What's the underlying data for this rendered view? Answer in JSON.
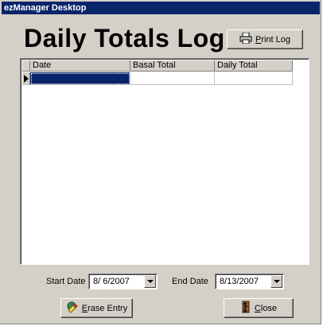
{
  "window": {
    "title": "ezManager Desktop"
  },
  "heading": "Daily Totals Log",
  "buttons": {
    "print_log": "Print Log",
    "erase_entry": "Erase Entry",
    "close": "Close"
  },
  "grid": {
    "columns": [
      "Date",
      "Basal Total",
      "Daily Total"
    ],
    "rows": [
      [
        "",
        "",
        ""
      ]
    ]
  },
  "filters": {
    "start_label": "Start Date",
    "start_value": "8/ 6/2007",
    "end_label": "End Date",
    "end_value": "8/13/2007"
  },
  "icons": {
    "print": "printer-icon",
    "erase": "eraser-icon",
    "close": "door-exit-icon"
  }
}
